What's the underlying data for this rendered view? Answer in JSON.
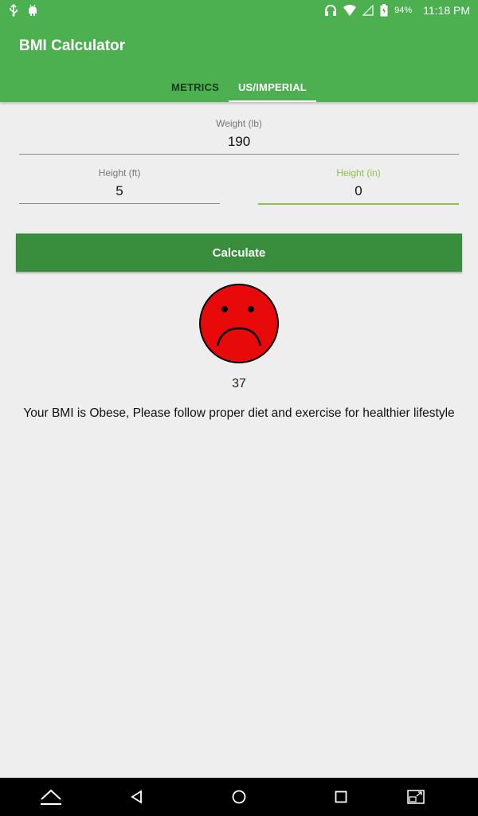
{
  "status_bar": {
    "icons_left": [
      "usb-icon",
      "android-debug-icon"
    ],
    "icons_right": [
      "headset-icon",
      "wifi-icon",
      "cell-signal-icon",
      "battery-icon"
    ],
    "battery": "94%",
    "time": "11:18 PM"
  },
  "app_bar": {
    "title": "BMI Calculator"
  },
  "tabs": [
    {
      "label": "METRICS",
      "active": false
    },
    {
      "label": "US/IMPERIAL",
      "active": true
    }
  ],
  "form": {
    "weight": {
      "label": "Weight (lb)",
      "value": "190"
    },
    "height_ft": {
      "label": "Height (ft)",
      "value": "5"
    },
    "height_in": {
      "label": "Height (in)",
      "value": "0",
      "focused": true
    },
    "calculate_label": "Calculate"
  },
  "result": {
    "face": "sad-face-icon",
    "bmi": "37",
    "message": "Your BMI is Obese, Please follow proper diet and exercise for healthier lifestyle"
  },
  "colors": {
    "primary": "#4caf50",
    "button": "#388e3c",
    "accent": "#8bc34a",
    "face_fill": "#e80a0a"
  },
  "nav_bar": {
    "icons": [
      "keyboard-hide-icon",
      "back-icon",
      "home-icon",
      "recents-icon",
      "screenshot-icon"
    ]
  }
}
